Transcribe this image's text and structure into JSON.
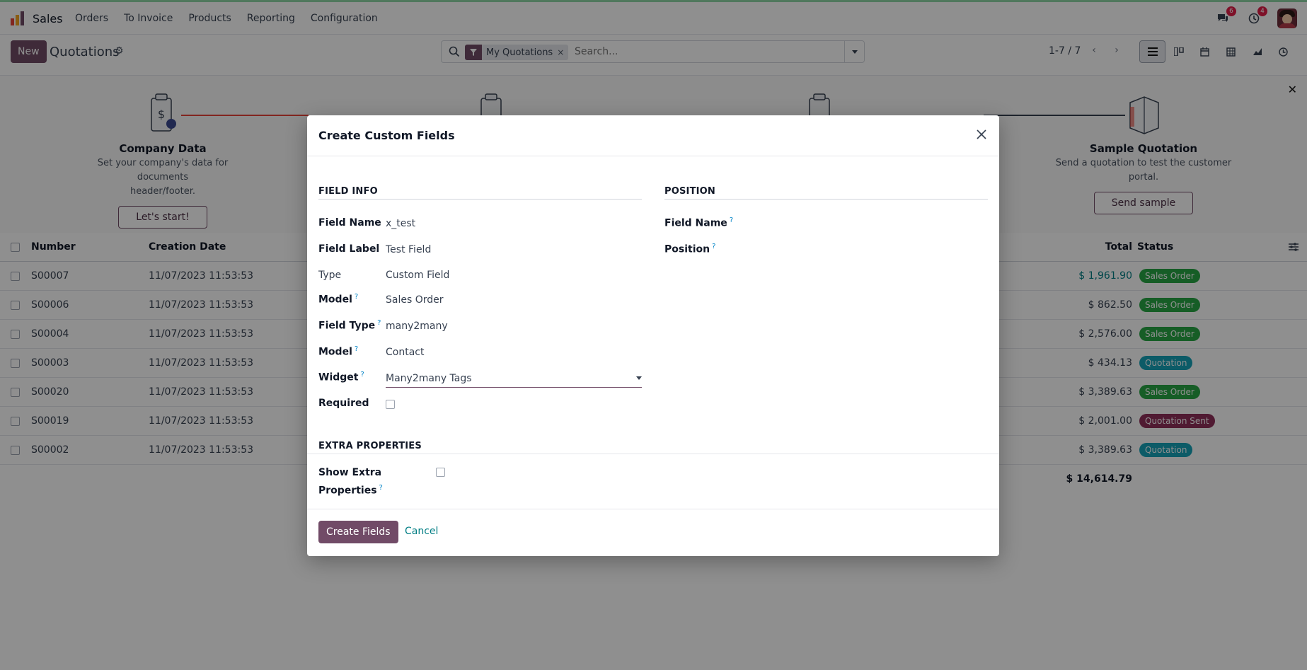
{
  "navbar": {
    "app_name": "Sales",
    "menu": [
      "Orders",
      "To Invoice",
      "Products",
      "Reporting",
      "Configuration"
    ],
    "messages_count": "6",
    "activities_count": "4"
  },
  "control_panel": {
    "new_label": "New",
    "title": "Quotations",
    "search": {
      "facet_label": "My Quotations",
      "facet_remove": "×",
      "placeholder": "Search..."
    },
    "pager": "1-7 / 7"
  },
  "banner": {
    "steps": [
      {
        "title": "Company Data",
        "desc_1": "Set your company's data for documents",
        "desc_2": "header/footer.",
        "button": "Let's start!"
      },
      {
        "title": "Sample Quotation",
        "desc_1": "Send a quotation to test the customer",
        "desc_2": "portal.",
        "button": "Send sample"
      }
    ]
  },
  "list": {
    "headers": {
      "number": "Number",
      "creation_date": "Creation Date",
      "total": "Total",
      "status": "Status"
    },
    "rows": [
      {
        "number": "S00007",
        "date": "11/07/2023 11:53:53",
        "total": "$ 1,961.90",
        "status": "Sales Order"
      },
      {
        "number": "S00006",
        "date": "11/07/2023 11:53:53",
        "total": "$ 862.50",
        "status": "Sales Order"
      },
      {
        "number": "S00004",
        "date": "11/07/2023 11:53:53",
        "total": "$ 2,576.00",
        "status": "Sales Order"
      },
      {
        "number": "S00003",
        "date": "11/07/2023 11:53:53",
        "total": "$ 434.13",
        "status": "Quotation"
      },
      {
        "number": "S00020",
        "date": "11/07/2023 11:53:53",
        "total": "$ 3,389.63",
        "status": "Sales Order"
      },
      {
        "number": "S00019",
        "date": "11/07/2023 11:53:53",
        "total": "$ 2,001.00",
        "status": "Quotation Sent"
      },
      {
        "number": "S00002",
        "date": "11/07/2023 11:53:53",
        "total": "$ 3,389.63",
        "status": "Quotation"
      }
    ],
    "grand_total": "$ 14,614.79"
  },
  "colors": {
    "primary": "#714b67",
    "sales_order": "#28a745",
    "quotation": "#17a2b8",
    "quotation_sent": "#8f2f5a",
    "link": "#017e84"
  },
  "dialog": {
    "title": "Create Custom Fields",
    "field_info": {
      "section": "FIELD INFO",
      "field_name_label": "Field Name",
      "field_name_value": "x_test",
      "field_label_label": "Field Label",
      "field_label_value": "Test Field",
      "type_label": "Type",
      "type_value": "Custom Field",
      "model_label": "Model",
      "model_value": "Sales Order",
      "field_type_label": "Field Type",
      "field_type_value": "many2many",
      "relation_model_label": "Model",
      "relation_model_value": "Contact",
      "widget_label": "Widget",
      "widget_value": "Many2many Tags",
      "required_label": "Required"
    },
    "position": {
      "section": "POSITION",
      "field_name_label": "Field Name",
      "position_label": "Position"
    },
    "extra": {
      "section": "EXTRA PROPERTIES",
      "show_extra_line1": "Show Extra",
      "show_extra_line2": "Properties"
    },
    "help_mark": "?",
    "create_button": "Create Fields",
    "cancel_button": "Cancel"
  }
}
